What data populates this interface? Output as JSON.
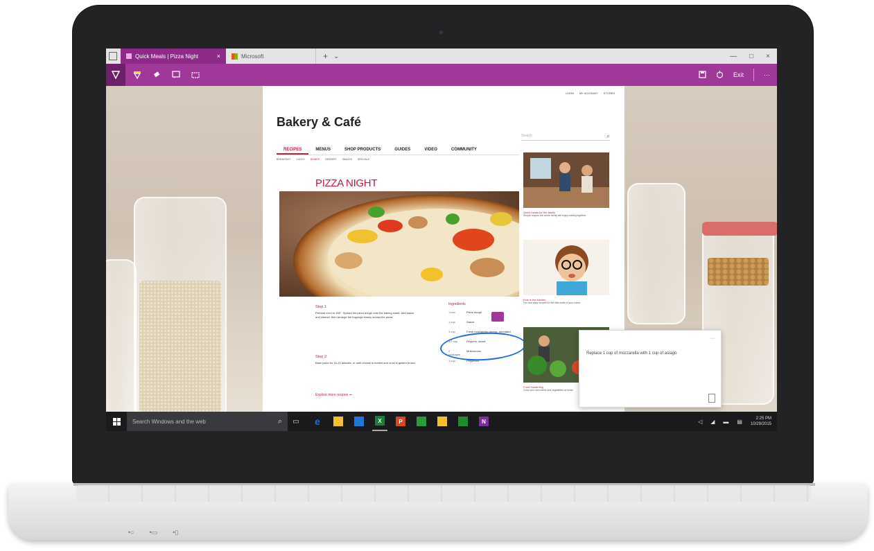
{
  "browser": {
    "active_tab_title": "Quick Meals | Pizza Night",
    "inactive_tab_title": "Microsoft",
    "tab_close_glyph": "×",
    "new_tab_glyph": "+",
    "window_controls": [
      "—",
      "□",
      "×"
    ],
    "accent_color": "#a0389a",
    "toolbar_right_label": "Exit",
    "more_glyph": "···"
  },
  "toolbar_tools": [
    "pen-icon",
    "highlighter-icon",
    "eraser-icon",
    "add-note-icon",
    "clip-icon"
  ],
  "webpage": {
    "top_links": [
      "LOGIN",
      "MY ACCOUNT",
      "STORES"
    ],
    "site_title": "Bakery & Café",
    "search_placeholder": "Search",
    "nav": [
      "RECIPES",
      "MENUS",
      "SHOP PRODUCTS",
      "GUIDES",
      "VIDEO",
      "COMMUNITY"
    ],
    "subnav": [
      "BREAKFAST",
      "LUNCH",
      "DINNER",
      "DESSERT",
      "SNACKS",
      "SPECIALS"
    ],
    "recipe_title": "PIZZA NIGHT",
    "step1_heading": "Step 1",
    "step1_text": "Preheat oven to 450°. Spread the pizza dough onto the baking sheet. Add sauce and cheese, then arrange the toppings evenly across the pizza.",
    "step2_heading": "Step 2",
    "step2_text": "Bake pizza for 15-20 minutes, or until cheese is melted and crust is golden brown.",
    "explore_link": "Explore more recipes ➞",
    "ingredients_heading": "Ingredients",
    "ingredients": [
      {
        "qty": "1 box",
        "item": "Pizza dough"
      },
      {
        "qty": "1 cup",
        "item": "Sauce"
      },
      {
        "qty": "1 cup",
        "item": "Fresh mozzarella cheese, shredded"
      },
      {
        "qty": "1/2 cup",
        "item": "Peppers, sliced"
      },
      {
        "qty": "2 packages",
        "item": "Mushrooms"
      },
      {
        "qty": "1 cup",
        "item": "Pepperoni"
      }
    ],
    "sidebar_cards": [
      {
        "title": "Quick meals for the family",
        "text": "Simple recipes the whole family will enjoy making together."
      },
      {
        "title": "Kids in the kitchen",
        "text": "Fun and easy recipes for the little chefs in your home."
      },
      {
        "title": "Food Gardening",
        "text": "Grow your own herbs and vegetables at home."
      }
    ]
  },
  "note": {
    "text": "Replace 1 cup of mozzarella with 1 cup of asiago",
    "more_glyph": "···"
  },
  "taskbar": {
    "search_placeholder": "Search Windows and the web",
    "apps": [
      {
        "name": "edge-icon",
        "color": "#1e6fd6",
        "glyph": "e"
      },
      {
        "name": "file-explorer-icon",
        "color": "#f2c12e",
        "glyph": ""
      },
      {
        "name": "store-icon",
        "color": "#1e78d6",
        "glyph": ""
      },
      {
        "name": "excel-icon",
        "color": "#1e7d3a",
        "glyph": "X"
      },
      {
        "name": "powerpoint-icon",
        "color": "#d24726",
        "glyph": "P"
      },
      {
        "name": "money-icon",
        "color": "#2a9a3a",
        "glyph": ""
      },
      {
        "name": "sticky-notes-icon",
        "color": "#f2c12e",
        "glyph": ""
      },
      {
        "name": "xbox-icon",
        "color": "#1f8a2f",
        "glyph": ""
      },
      {
        "name": "onenote-icon",
        "color": "#7a2f9a",
        "glyph": "N"
      }
    ],
    "clock_time": "2:25 PM",
    "clock_date": "10/29/2015"
  },
  "laptop": {
    "ports": [
      "•○",
      "•▭",
      "•▯"
    ]
  }
}
